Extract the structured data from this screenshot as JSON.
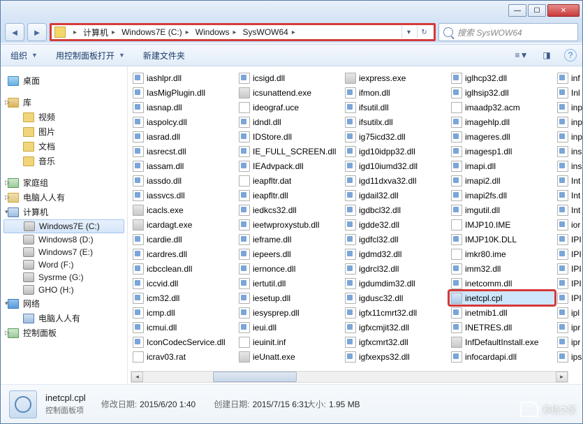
{
  "breadcrumb": {
    "root_icon": "folder-icon",
    "items": [
      "计算机",
      "Windows7E (C:)",
      "Windows",
      "SysWOW64"
    ]
  },
  "search": {
    "placeholder": "搜索 SysWOW64"
  },
  "toolbar": {
    "organize": "组织",
    "open_cpl": "用控制面板打开",
    "new_folder": "新建文件夹"
  },
  "nav": {
    "desktop": "桌面",
    "libraries": "库",
    "lib_items": [
      "视频",
      "图片",
      "文档",
      "音乐"
    ],
    "homegroup": "家庭组",
    "user": "电脑人人有",
    "computer": "计算机",
    "drives": [
      "Windows7E (C:)",
      "Windows8 (D:)",
      "Windows7 (E:)",
      "Word (F:)",
      "Sysrme (G:)",
      "GHO (H:)"
    ],
    "network": "网络",
    "network_child": "电脑人人有",
    "control_panel": "控制面板"
  },
  "files": {
    "col1": [
      {
        "n": "iashlpr.dll",
        "t": "dll"
      },
      {
        "n": "IasMigPlugin.dll",
        "t": "dll"
      },
      {
        "n": "iasnap.dll",
        "t": "dll"
      },
      {
        "n": "iaspolcy.dll",
        "t": "dll"
      },
      {
        "n": "iasrad.dll",
        "t": "dll"
      },
      {
        "n": "iasrecst.dll",
        "t": "dll"
      },
      {
        "n": "iassam.dll",
        "t": "dll"
      },
      {
        "n": "iassdo.dll",
        "t": "dll"
      },
      {
        "n": "iassvcs.dll",
        "t": "dll"
      },
      {
        "n": "icacls.exe",
        "t": "exe"
      },
      {
        "n": "icardagt.exe",
        "t": "exe"
      },
      {
        "n": "icardie.dll",
        "t": "dll"
      },
      {
        "n": "icardres.dll",
        "t": "dll"
      },
      {
        "n": "icbcclean.dll",
        "t": "dll"
      },
      {
        "n": "iccvid.dll",
        "t": "dll"
      },
      {
        "n": "icm32.dll",
        "t": "dll"
      },
      {
        "n": "icmp.dll",
        "t": "dll"
      },
      {
        "n": "icmui.dll",
        "t": "dll"
      },
      {
        "n": "IconCodecService.dll",
        "t": "dll"
      },
      {
        "n": "icrav03.rat",
        "t": "dat"
      }
    ],
    "col2": [
      {
        "n": "icsigd.dll",
        "t": "dll"
      },
      {
        "n": "icsunattend.exe",
        "t": "exe"
      },
      {
        "n": "ideograf.uce",
        "t": "dat"
      },
      {
        "n": "idndl.dll",
        "t": "dll"
      },
      {
        "n": "IDStore.dll",
        "t": "dll"
      },
      {
        "n": "IE_FULL_SCREEN.dll",
        "t": "dll"
      },
      {
        "n": "IEAdvpack.dll",
        "t": "dll"
      },
      {
        "n": "ieapfltr.dat",
        "t": "dat"
      },
      {
        "n": "ieapfltr.dll",
        "t": "dll"
      },
      {
        "n": "iedkcs32.dll",
        "t": "dll"
      },
      {
        "n": "ieetwproxystub.dll",
        "t": "dll"
      },
      {
        "n": "ieframe.dll",
        "t": "dll"
      },
      {
        "n": "iepeers.dll",
        "t": "dll"
      },
      {
        "n": "iernonce.dll",
        "t": "dll"
      },
      {
        "n": "iertutil.dll",
        "t": "dll"
      },
      {
        "n": "iesetup.dll",
        "t": "dll"
      },
      {
        "n": "iesysprep.dll",
        "t": "dll"
      },
      {
        "n": "ieui.dll",
        "t": "dll"
      },
      {
        "n": "ieuinit.inf",
        "t": "dat"
      },
      {
        "n": "ieUnatt.exe",
        "t": "exe"
      }
    ],
    "col3": [
      {
        "n": "iexpress.exe",
        "t": "exe"
      },
      {
        "n": "ifmon.dll",
        "t": "dll"
      },
      {
        "n": "ifsutil.dll",
        "t": "dll"
      },
      {
        "n": "ifsutilx.dll",
        "t": "dll"
      },
      {
        "n": "ig75icd32.dll",
        "t": "dll"
      },
      {
        "n": "igd10idpp32.dll",
        "t": "dll"
      },
      {
        "n": "igd10iumd32.dll",
        "t": "dll"
      },
      {
        "n": "igd11dxva32.dll",
        "t": "dll"
      },
      {
        "n": "igdail32.dll",
        "t": "dll"
      },
      {
        "n": "igdbcl32.dll",
        "t": "dll"
      },
      {
        "n": "igdde32.dll",
        "t": "dll"
      },
      {
        "n": "igdfcl32.dll",
        "t": "dll"
      },
      {
        "n": "igdmd32.dll",
        "t": "dll"
      },
      {
        "n": "igdrcl32.dll",
        "t": "dll"
      },
      {
        "n": "igdumdim32.dll",
        "t": "dll"
      },
      {
        "n": "igdusc32.dll",
        "t": "dll"
      },
      {
        "n": "igfx11cmrt32.dll",
        "t": "dll"
      },
      {
        "n": "igfxcmjit32.dll",
        "t": "dll"
      },
      {
        "n": "igfxcmrt32.dll",
        "t": "dll"
      },
      {
        "n": "igfxexps32.dll",
        "t": "dll"
      }
    ],
    "col4": [
      {
        "n": "iglhcp32.dll",
        "t": "dll"
      },
      {
        "n": "iglhsip32.dll",
        "t": "dll"
      },
      {
        "n": "imaadp32.acm",
        "t": "dat"
      },
      {
        "n": "imagehlp.dll",
        "t": "dll"
      },
      {
        "n": "imageres.dll",
        "t": "dll"
      },
      {
        "n": "imagesp1.dll",
        "t": "dll"
      },
      {
        "n": "imapi.dll",
        "t": "dll"
      },
      {
        "n": "imapi2.dll",
        "t": "dll"
      },
      {
        "n": "imapi2fs.dll",
        "t": "dll"
      },
      {
        "n": "imgutil.dll",
        "t": "dll"
      },
      {
        "n": "IMJP10.IME",
        "t": "dat"
      },
      {
        "n": "IMJP10K.DLL",
        "t": "dll"
      },
      {
        "n": "imkr80.ime",
        "t": "dat"
      },
      {
        "n": "imm32.dll",
        "t": "dll"
      },
      {
        "n": "inetcomm.dll",
        "t": "dll"
      },
      {
        "n": "inetcpl.cpl",
        "t": "cpl",
        "sel": true,
        "hl": true
      },
      {
        "n": "inetmib1.dll",
        "t": "dll"
      },
      {
        "n": "INETRES.dll",
        "t": "dll"
      },
      {
        "n": "InfDefaultInstall.exe",
        "t": "exe"
      },
      {
        "n": "infocardapi.dll",
        "t": "dll"
      }
    ],
    "col5": [
      {
        "n": "inf",
        "t": "dll"
      },
      {
        "n": "Inl",
        "t": "dll"
      },
      {
        "n": "inp",
        "t": "dll"
      },
      {
        "n": "inp",
        "t": "dll"
      },
      {
        "n": "inp",
        "t": "dll"
      },
      {
        "n": "ins",
        "t": "dll"
      },
      {
        "n": "ins",
        "t": "dll"
      },
      {
        "n": "Int",
        "t": "dll"
      },
      {
        "n": "Int",
        "t": "dll"
      },
      {
        "n": "Int",
        "t": "dll"
      },
      {
        "n": "ior",
        "t": "dll"
      },
      {
        "n": "IPI",
        "t": "dll"
      },
      {
        "n": "IPI",
        "t": "dll"
      },
      {
        "n": "IPI",
        "t": "dll"
      },
      {
        "n": "IPI",
        "t": "dll"
      },
      {
        "n": "IPI",
        "t": "dll"
      },
      {
        "n": "ipl",
        "t": "dll"
      },
      {
        "n": "ipr",
        "t": "dll"
      },
      {
        "n": "ipr",
        "t": "dll"
      },
      {
        "n": "ips",
        "t": "dll"
      }
    ]
  },
  "details": {
    "filename": "inetcpl.cpl",
    "filetype": "控制面板项",
    "modified_label": "修改日期:",
    "modified_value": "2015/6/20 1:40",
    "size_label": "大小:",
    "size_value": "1.95 MB",
    "created_label": "创建日期:",
    "created_value": "2015/7/15 6:31"
  },
  "watermark": "系统之家"
}
